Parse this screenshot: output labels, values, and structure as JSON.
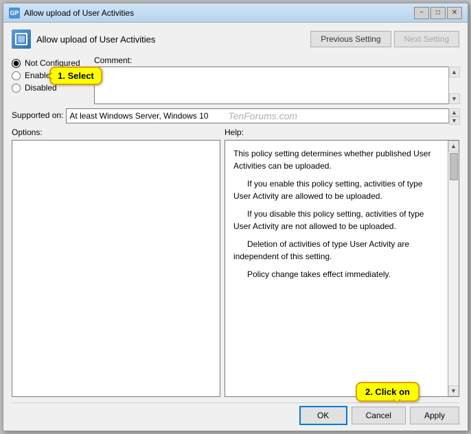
{
  "window": {
    "title": "Allow upload of User Activities",
    "icon": "policy-icon"
  },
  "header": {
    "title": "Allow upload of User Activities",
    "prev_btn": "Previous Setting",
    "next_btn": "Next Setting"
  },
  "radio_group": {
    "options": [
      {
        "id": "not-configured",
        "label": "Not Configured",
        "checked": true
      },
      {
        "id": "enabled",
        "label": "Enabled",
        "checked": false
      },
      {
        "id": "disabled",
        "label": "Disabled",
        "checked": false
      }
    ]
  },
  "annotation1": {
    "text": "1. Select"
  },
  "comment": {
    "label": "Comment:"
  },
  "supported": {
    "label": "Supported on:",
    "value": "At least Windows Server, Windows 10",
    "watermark": "TenForums.com"
  },
  "panels": {
    "options_label": "Options:",
    "help_label": "Help:",
    "help_text": [
      "This policy setting determines whether published User Activities can be uploaded.",
      "If you enable this policy setting, activities of type User Activity are allowed to be uploaded.",
      "If you disable this policy setting, activities of type User Activity are not allowed to be uploaded.",
      "Deletion of activities of type User Activity are independent of this setting.",
      "Policy change takes effect immediately."
    ]
  },
  "annotation2": {
    "text": "2. Click on"
  },
  "buttons": {
    "ok": "OK",
    "cancel": "Cancel",
    "apply": "Apply"
  },
  "title_buttons": {
    "minimize": "−",
    "maximize": "□",
    "close": "✕"
  }
}
